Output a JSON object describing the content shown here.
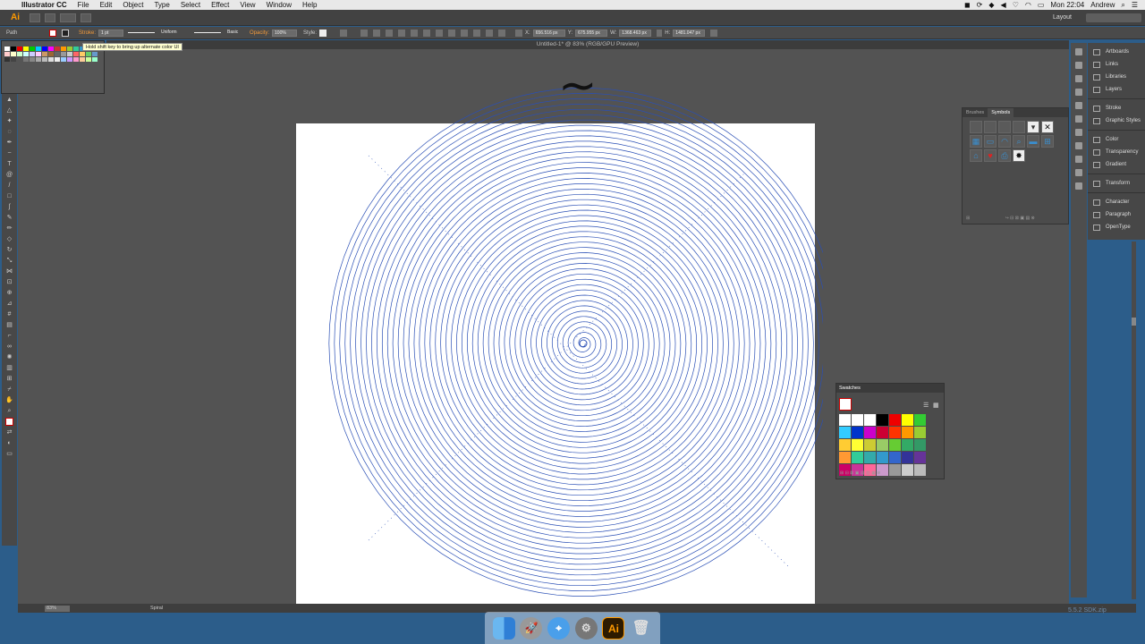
{
  "menubar": {
    "app_name": "Illustrator CC",
    "items": [
      "File",
      "Edit",
      "Object",
      "Type",
      "Select",
      "Effect",
      "View",
      "Window",
      "Help"
    ],
    "clock": "Mon 22:04",
    "user": "Andrew"
  },
  "appbar": {
    "logo": "Ai",
    "workspace": "Layout"
  },
  "controlbar": {
    "selection_label": "Path",
    "stroke_label": "Stroke:",
    "stroke_weight": "1 pt",
    "profile": "Uniform",
    "brush": "Basic",
    "opacity_label": "Opacity:",
    "opacity_value": "100%",
    "style_label": "Style:",
    "x_label": "X:",
    "x_value": "656.516 px",
    "y_label": "Y:",
    "y_value": "675.955 px",
    "w_label": "W:",
    "w_value": "1368.463 px",
    "h_label": "H:",
    "h_value": "1481.047 px"
  },
  "tooltip": "Hold shift key to bring up alternate color UI",
  "document_title": "Untitled-1* @ 83% (RGB/GPU Preview)",
  "dock_panel": {
    "items": [
      "Artboards",
      "Links",
      "Libraries",
      "Layers",
      "Stroke",
      "Graphic Styles",
      "Color",
      "Transparency",
      "Gradient",
      "Transform",
      "Character",
      "Paragraph",
      "OpenType"
    ]
  },
  "symbols_panel": {
    "tabs": [
      "Brushes",
      "Symbols"
    ],
    "active_tab": "Symbols"
  },
  "swatches_panel": {
    "title": "Swatches"
  },
  "statusbar": {
    "zoom": "83%",
    "current_tool": "Spiral"
  },
  "dock": {
    "apps": [
      "Finder",
      "Launchpad",
      "Safari",
      "System Preferences",
      "Adobe Illustrator CC",
      "Trash"
    ],
    "illustrator_label": "Ai"
  },
  "watermark": "5.5.2 SDK.zip",
  "colors": {
    "spiral_stroke": "#2a4fb5",
    "accent": "#ff9a00",
    "desktop": "#2c5d8a"
  }
}
